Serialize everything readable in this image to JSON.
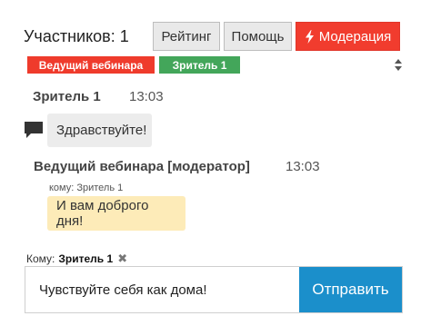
{
  "header": {
    "participants_label": "Участников: 1",
    "buttons": {
      "rating": "Рейтинг",
      "help": "Помощь",
      "moderation": "Модерация"
    }
  },
  "tags": {
    "host": "Ведущий вебинара",
    "viewer": "Зритель 1"
  },
  "messages": [
    {
      "author": "Зритель 1",
      "time": "13:03",
      "text": "Здравствуйте!"
    },
    {
      "author": "Ведущий вебинара [модератор]",
      "time": "13:03",
      "to": "кому: Зритель 1",
      "text": "И вам доброго дня!"
    }
  ],
  "composer": {
    "to_label": "Кому:",
    "to_name": "Зритель 1",
    "input_value": "Чувствуйте себя как дома!",
    "send_label": "Отправить"
  },
  "colors": {
    "moderation": "#f13c2e",
    "host_tag": "#ef3b2c",
    "viewer_tag": "#43a65a",
    "send": "#1b8fcb",
    "grey_bubble": "#ececec",
    "yellow_bubble": "#fdebb8"
  },
  "icons": {
    "moderation": "lightning-icon",
    "message": "chat-bubble-icon",
    "remove_recipient": "close-icon"
  }
}
